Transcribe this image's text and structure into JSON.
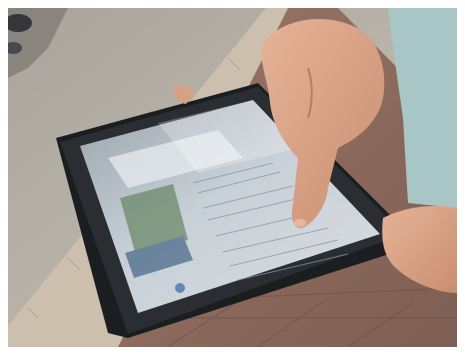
{
  "scene": {
    "description_hidden": "",
    "tablet": {
      "color_frame": "#1c1f22",
      "color_screen": "#cfd6dd"
    },
    "colors": {
      "sidewalk": "#b8b2a8",
      "tile": "#c9b9a6",
      "brick": "#8a6a5c",
      "skin": "#d9a285",
      "shirt": "#a7c6c6"
    }
  }
}
